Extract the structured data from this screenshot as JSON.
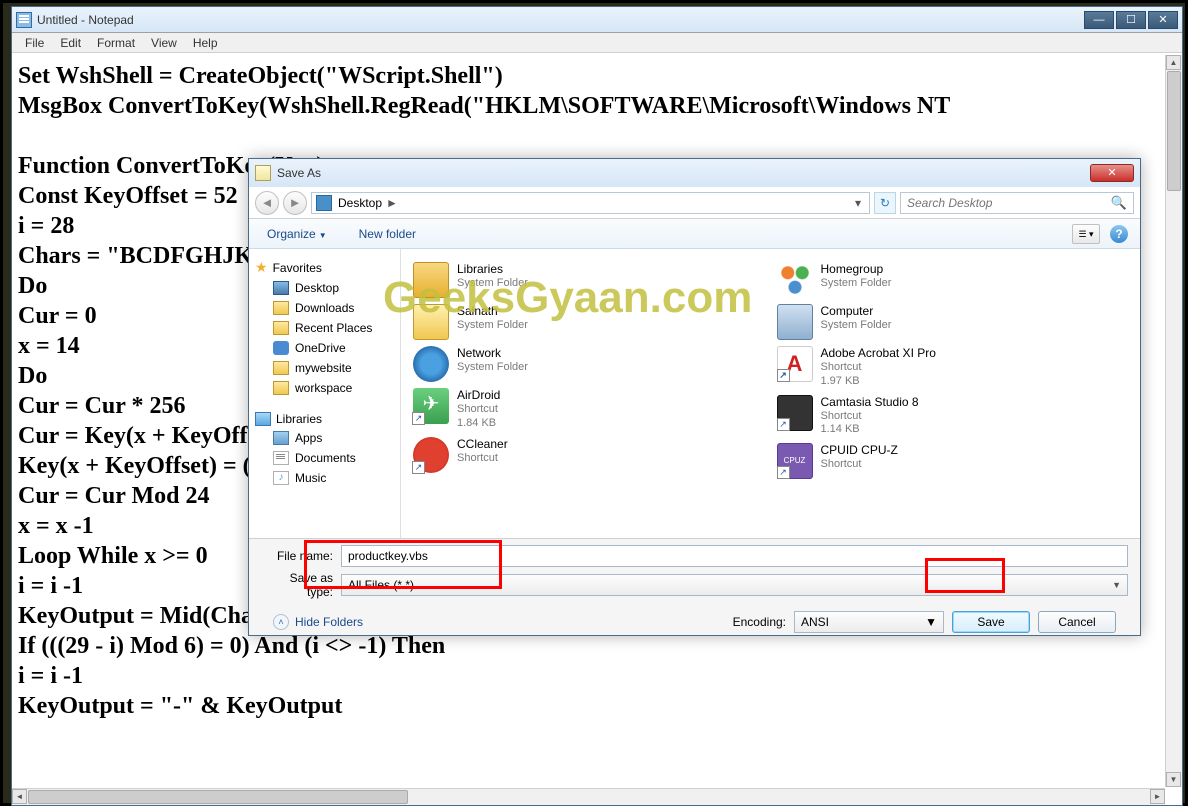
{
  "notepad": {
    "title": "Untitled - Notepad",
    "menu": [
      "File",
      "Edit",
      "Format",
      "View",
      "Help"
    ],
    "content": "Set WshShell = CreateObject(\"WScript.Shell\")\nMsgBox ConvertToKey(WshShell.RegRead(\"HKLM\\SOFTWARE\\Microsoft\\Windows NT\n\nFunction ConvertToKey(Key)\nConst KeyOffset = 52\ni = 28\nChars = \"BCDFGHJKMPQRTVWXY2346789\"\nDo\nCur = 0\nx = 14\nDo\nCur = Cur * 256\nCur = Key(x + KeyOffset) + Cur\nKey(x + KeyOffset) = (Cur \\ 24) And 255\nCur = Cur Mod 24\nx = x -1\nLoop While x >= 0\ni = i -1\nKeyOutput = Mid(Chars, Cur + 1, 1) & KeyOutput\nIf (((29 - i) Mod 6) = 0) And (i <> -1) Then\ni = i -1\nKeyOutput = \"-\" & KeyOutput"
  },
  "saveas": {
    "title": "Save As",
    "breadcrumb": "Desktop",
    "search_placeholder": "Search Desktop",
    "toolbar": {
      "organize": "Organize",
      "newfolder": "New folder"
    },
    "nav": {
      "favorites": "Favorites",
      "fav_items": [
        "Desktop",
        "Downloads",
        "Recent Places",
        "OneDrive",
        "mywebsite",
        "workspace"
      ],
      "libraries": "Libraries",
      "lib_items": [
        "Apps",
        "Documents",
        "Music"
      ]
    },
    "items_left": [
      {
        "name": "Libraries",
        "sub": "System Folder"
      },
      {
        "name": "Sainath",
        "sub": "System Folder"
      },
      {
        "name": "Network",
        "sub": "System Folder"
      },
      {
        "name": "AirDroid",
        "sub": "Shortcut",
        "size": "1.84 KB"
      },
      {
        "name": "CCleaner",
        "sub": "Shortcut"
      }
    ],
    "items_right": [
      {
        "name": "Homegroup",
        "sub": "System Folder"
      },
      {
        "name": "Computer",
        "sub": "System Folder"
      },
      {
        "name": "Adobe Acrobat XI Pro",
        "sub": "Shortcut",
        "size": "1.97 KB"
      },
      {
        "name": "Camtasia Studio 8",
        "sub": "Shortcut",
        "size": "1.14 KB"
      },
      {
        "name": "CPUID CPU-Z",
        "sub": "Shortcut"
      }
    ],
    "filename_label": "File name:",
    "filename_value": "productkey.vbs",
    "type_label": "Save as type:",
    "type_value": "All Files  (*.*)",
    "hide_folders": "Hide Folders",
    "encoding_label": "Encoding:",
    "encoding_value": "ANSI",
    "save_btn": "Save",
    "cancel_btn": "Cancel"
  },
  "watermark": "GeeksGyaan.com"
}
